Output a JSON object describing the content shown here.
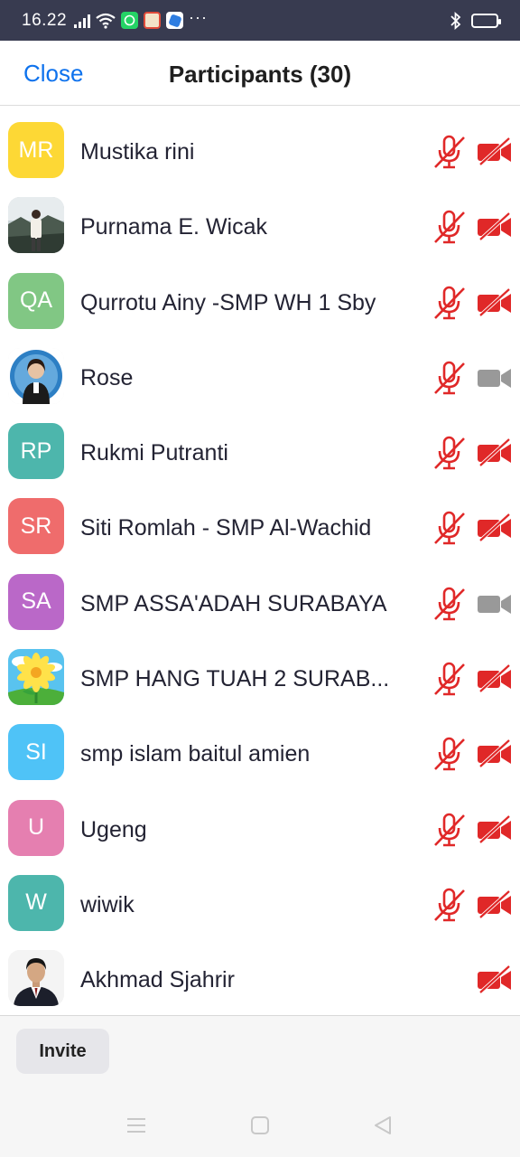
{
  "status_bar": {
    "time": "16.22",
    "more": "···",
    "icons": [
      "signal-icon",
      "wifi-icon",
      "whatsapp-icon",
      "app-icon",
      "app-icon",
      "bluetooth-icon",
      "battery-icon"
    ]
  },
  "header": {
    "close_label": "Close",
    "title": "Participants (30)"
  },
  "participants": [
    {
      "name": "Mustika rini",
      "initials": "MR",
      "color": "#fdd835",
      "mic": "muted",
      "video": "off"
    },
    {
      "name": "Purnama E. Wicak",
      "initials": "",
      "photo": "landscape",
      "mic": "muted",
      "video": "off"
    },
    {
      "name": "Qurrotu Ainy -SMP WH 1 Sby",
      "initials": "QA",
      "color": "#81c784",
      "mic": "muted",
      "video": "off"
    },
    {
      "name": "Rose",
      "initials": "",
      "photo": "portrait-blue",
      "mic": "muted",
      "video": "on"
    },
    {
      "name": "Rukmi Putranti",
      "initials": "RP",
      "color": "#4db6ac",
      "mic": "muted",
      "video": "off"
    },
    {
      "name": "Siti Romlah - SMP Al-Wachid",
      "initials": "SR",
      "color": "#ef6c6c",
      "mic": "muted",
      "video": "off"
    },
    {
      "name": "SMP ASSA'ADAH SURABAYA",
      "initials": "SA",
      "color": "#ba68c8",
      "mic": "muted",
      "video": "on"
    },
    {
      "name": "SMP HANG TUAH 2 SURAB...",
      "initials": "",
      "photo": "flower",
      "mic": "muted",
      "video": "off"
    },
    {
      "name": "smp islam baitul amien",
      "initials": "SI",
      "color": "#4fc3f7",
      "mic": "muted",
      "video": "off"
    },
    {
      "name": "Ugeng",
      "initials": "U",
      "color": "#e57fb0",
      "mic": "muted",
      "video": "off"
    },
    {
      "name": "wiwik",
      "initials": "W",
      "color": "#4db6ac",
      "mic": "muted",
      "video": "off"
    },
    {
      "name": "Akhmad Sjahrir",
      "initials": "",
      "photo": "portrait-suit",
      "mic": "none",
      "video": "off"
    }
  ],
  "footer": {
    "invite_label": "Invite"
  },
  "nav": {
    "icons": [
      "menu-icon",
      "home-icon",
      "back-icon"
    ]
  },
  "colors": {
    "accent": "#0e72ed",
    "muted_red": "#e02828",
    "video_on_gray": "#999999",
    "status_bar_bg": "#383b50"
  }
}
